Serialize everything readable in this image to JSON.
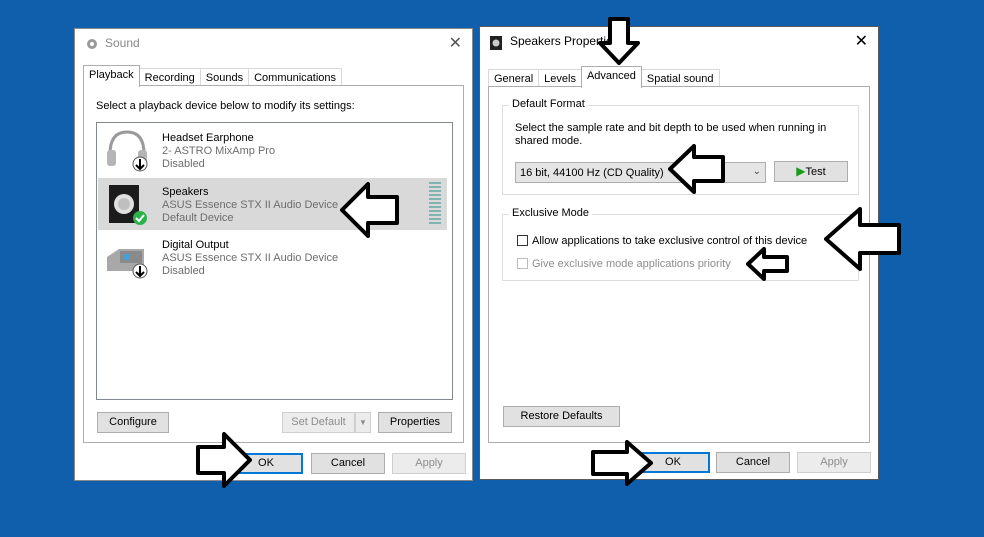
{
  "sound": {
    "title": "Sound",
    "tabs": [
      "Playback",
      "Recording",
      "Sounds",
      "Communications"
    ],
    "active_tab": "Playback",
    "instruction": "Select a playback device below to modify its settings:",
    "devices": [
      {
        "name": "Headset Earphone",
        "desc": "2- ASTRO MixAmp Pro",
        "status": "Disabled",
        "icon": "headset-icon"
      },
      {
        "name": "Speakers",
        "desc": "ASUS Essence STX II Audio Device",
        "status": "Default Device",
        "icon": "speaker-icon",
        "selected": true
      },
      {
        "name": "Digital Output",
        "desc": "ASUS Essence STX II Audio Device",
        "status": "Disabled",
        "icon": "digital-output-icon"
      }
    ],
    "buttons": {
      "configure": "Configure",
      "set_default": "Set Default",
      "properties": "Properties",
      "ok": "OK",
      "cancel": "Cancel",
      "apply": "Apply"
    }
  },
  "props": {
    "title": "Speakers Properties",
    "tabs": [
      "General",
      "Levels",
      "Advanced",
      "Spatial sound"
    ],
    "active_tab": "Advanced",
    "default_format": {
      "label": "Default Format",
      "text": "Select the sample rate and bit depth to be used when running in shared mode.",
      "selected": "16 bit, 44100 Hz (CD Quality)",
      "test": "Test"
    },
    "exclusive": {
      "label": "Exclusive Mode",
      "allow": "Allow applications to take exclusive control of this device",
      "priority": "Give exclusive mode applications priority"
    },
    "buttons": {
      "restore": "Restore Defaults",
      "ok": "OK",
      "cancel": "Cancel",
      "apply": "Apply"
    }
  },
  "colors": {
    "desktop": "#0f5fad",
    "accent": "#0078d7",
    "test_play": "#1a9c1a",
    "default_check": "#2bb24c"
  }
}
